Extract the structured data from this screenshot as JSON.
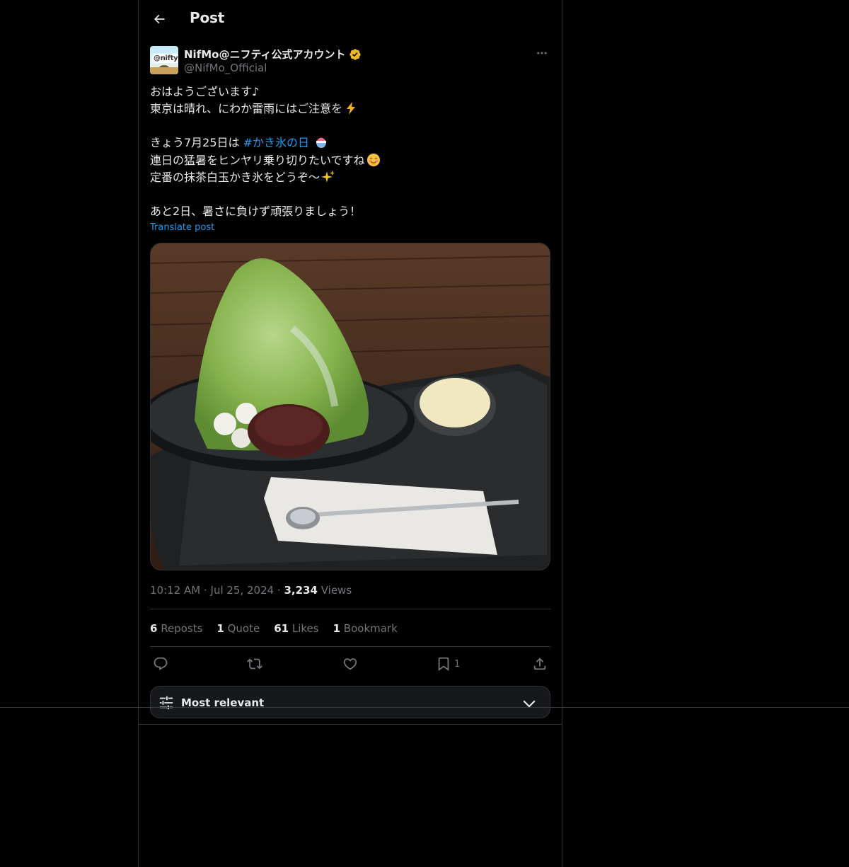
{
  "header": {
    "title": "Post"
  },
  "author": {
    "display_name": "NifMo@ニフティ公式アカウント",
    "handle": "@NifMo_Official",
    "avatar_text": "@nifty"
  },
  "tweet": {
    "line1": "おはようございます♪",
    "line2": "東京は晴れ、にわか雷雨にはご注意を",
    "line3_prefix": "きょう7月25日は ",
    "hashtag": "#かき氷の日",
    "line4": "連日の猛暑をヒンヤリ乗り切りたいですね",
    "line5": "定番の抹茶白玉かき氷をどうぞ〜",
    "line6": "あと2日、暑さに負けず頑張りましょう！",
    "translate_label": "Translate post"
  },
  "meta": {
    "time": "10:12 AM",
    "sep1": " · ",
    "date": "Jul 25, 2024",
    "sep2": " · ",
    "views_count": "3,234",
    "views_label": " Views"
  },
  "stats": {
    "reposts_count": "6",
    "reposts_label": " Reposts",
    "quotes_count": "1",
    "quotes_label": " Quote",
    "likes_count": "61",
    "likes_label": " Likes",
    "bookmarks_count": "1",
    "bookmarks_label": " Bookmark"
  },
  "actions": {
    "bookmark_count": "1"
  },
  "sort": {
    "label": "Most relevant"
  },
  "colors": {
    "accent": "#1d9bf0",
    "text": "#e7e9ea",
    "muted": "#71767b",
    "border": "#2f3336",
    "verified": "#e8b829"
  },
  "icons": {
    "back": "arrow-left-icon",
    "verified": "verified-badge-icon",
    "more": "more-icon",
    "reply": "reply-icon",
    "repost": "repost-icon",
    "like": "heart-icon",
    "bookmark": "bookmark-icon",
    "share": "share-icon",
    "sort": "sliders-icon",
    "chevron": "chevron-down-icon"
  }
}
